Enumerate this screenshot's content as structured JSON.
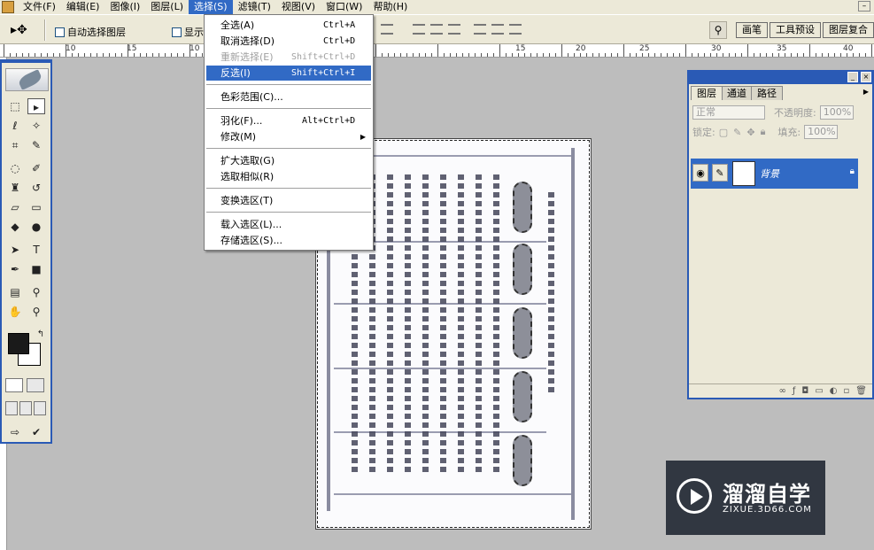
{
  "menubar": {
    "items": [
      "文件(F)",
      "编辑(E)",
      "图像(I)",
      "图层(L)",
      "选择(S)",
      "滤镜(T)",
      "视图(V)",
      "窗口(W)",
      "帮助(H)"
    ],
    "active_index": 4
  },
  "options": {
    "auto_select_label": "自动选择图层",
    "show_label": "显示",
    "well_tabs": [
      "画笔",
      "工具预设",
      "图层复合"
    ]
  },
  "ruler": {
    "labels": [
      "10",
      "15",
      "10",
      "15",
      "20",
      "25",
      "30",
      "35",
      "40"
    ]
  },
  "select_menu": {
    "items": [
      {
        "label": "全选(A)",
        "shortcut": "Ctrl+A",
        "state": "normal"
      },
      {
        "label": "取消选择(D)",
        "shortcut": "Ctrl+D",
        "state": "normal"
      },
      {
        "label": "重新选择(E)",
        "shortcut": "Shift+Ctrl+D",
        "state": "disabled"
      },
      {
        "label": "反选(I)",
        "shortcut": "Shift+Ctrl+I",
        "state": "highlighted"
      },
      {
        "label": "色彩范围(C)...",
        "shortcut": "",
        "state": "normal"
      },
      {
        "label": "羽化(F)...",
        "shortcut": "Alt+Ctrl+D",
        "state": "normal"
      },
      {
        "label": "修改(M)",
        "shortcut": "",
        "state": "normal",
        "submenu": true
      },
      {
        "label": "扩大选取(G)",
        "shortcut": "",
        "state": "normal"
      },
      {
        "label": "选取相似(R)",
        "shortcut": "",
        "state": "normal"
      },
      {
        "label": "变换选区(T)",
        "shortcut": "",
        "state": "normal"
      },
      {
        "label": "载入选区(L)...",
        "shortcut": "",
        "state": "normal"
      },
      {
        "label": "存储选区(S)...",
        "shortcut": "",
        "state": "normal"
      }
    ]
  },
  "layers_panel": {
    "tabs": [
      "图层",
      "通道",
      "路径"
    ],
    "blend_mode": "正常",
    "opacity_label": "不透明度:",
    "opacity_value": "100%",
    "lock_label": "锁定:",
    "fill_label": "填充:",
    "fill_value": "100%",
    "layer_name": "背景"
  },
  "watermark": {
    "title": "溜溜自学",
    "url": "ZIXUE.3D66.COM"
  }
}
